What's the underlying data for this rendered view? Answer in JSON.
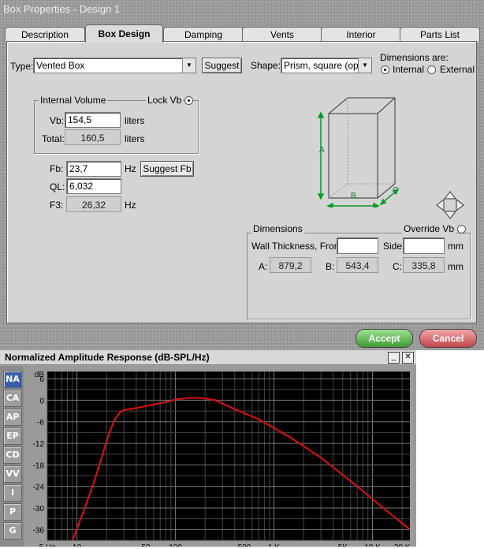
{
  "window": {
    "title": "Box Properties - Design 1"
  },
  "tabs": [
    "Description",
    "Box Design",
    "Damping",
    "Vents",
    "Interior",
    "Parts List"
  ],
  "type": {
    "label": "Type:",
    "value": "Vented Box",
    "suggest": "Suggest"
  },
  "shape": {
    "label": "Shape:",
    "value": "Prism, square (opt.)"
  },
  "dims_are": {
    "label": "Dimensions are:",
    "internal": "Internal",
    "external": "External"
  },
  "volume": {
    "group": "Internal Volume",
    "lock": "Lock Vb",
    "vb_label": "Vb:",
    "vb": "154,5",
    "vb_unit": "liters",
    "total_label": "Total:",
    "total": "160,5",
    "total_unit": "liters"
  },
  "tuning": {
    "fb_label": "Fb:",
    "fb": "23,7",
    "fb_unit": "Hz",
    "suggest_fb": "Suggest Fb",
    "ql_label": "QL:",
    "ql": "6,032",
    "f3_label": "F3:",
    "f3": "26,32",
    "f3_unit": "Hz"
  },
  "diagram": {
    "a": "A",
    "b": "B",
    "c": "C"
  },
  "dimensions": {
    "group": "Dimensions",
    "override": "Override Vb",
    "wall_label": "Wall Thickness, Front:",
    "front": "",
    "side_label": "Side:",
    "side": "",
    "side_unit": "mm",
    "a_label": "A:",
    "a": "879,2",
    "b_label": "B:",
    "b": "543,4",
    "c_label": "C:",
    "c": "335,8",
    "c_unit": "mm"
  },
  "buttons": {
    "accept": "Accept",
    "cancel": "Cancel"
  },
  "response": {
    "title": "Normalized Amplitude Response (dB-SPL/Hz)",
    "min": "_",
    "close": "✕",
    "side_buttons": [
      "NA",
      "CA",
      "AP",
      "EP",
      "CD",
      "VV",
      "I",
      "P",
      "G"
    ]
  },
  "chart_data": {
    "type": "line",
    "ylabel": "dB",
    "xscale": "log",
    "xlim": [
      5,
      24000
    ],
    "ylim": [
      -39,
      8
    ],
    "x_ticks": [
      5,
      10,
      50,
      100,
      500,
      1000,
      5000,
      10000,
      20000
    ],
    "x_tick_labels": [
      "5 Hz",
      "10",
      "50",
      "100",
      "500",
      "1 K",
      "5K",
      "10 K",
      "20 K"
    ],
    "y_ticks": [
      6,
      0,
      -6,
      -12,
      -18,
      -24,
      -30,
      -36
    ],
    "y_tick_labels": [
      "6",
      "0",
      "-6",
      "-12",
      "-18",
      "-24",
      "-30",
      "-36"
    ],
    "grid": true,
    "series_color": "#dd1010",
    "x": [
      9,
      12,
      15,
      18,
      21,
      24,
      27,
      30,
      40,
      60,
      80,
      100,
      130,
      170,
      250,
      400,
      700,
      1500,
      3000,
      6000,
      10000,
      15000,
      24000
    ],
    "y": [
      -39,
      -30,
      -22.5,
      -15.5,
      -9.5,
      -5.5,
      -3.5,
      -2.7,
      -2.2,
      -1.2,
      -0.5,
      0.2,
      0.6,
      0.7,
      0.1,
      -2.5,
      -5.3,
      -10.5,
      -16,
      -22.5,
      -27.5,
      -31.5,
      -36
    ]
  }
}
